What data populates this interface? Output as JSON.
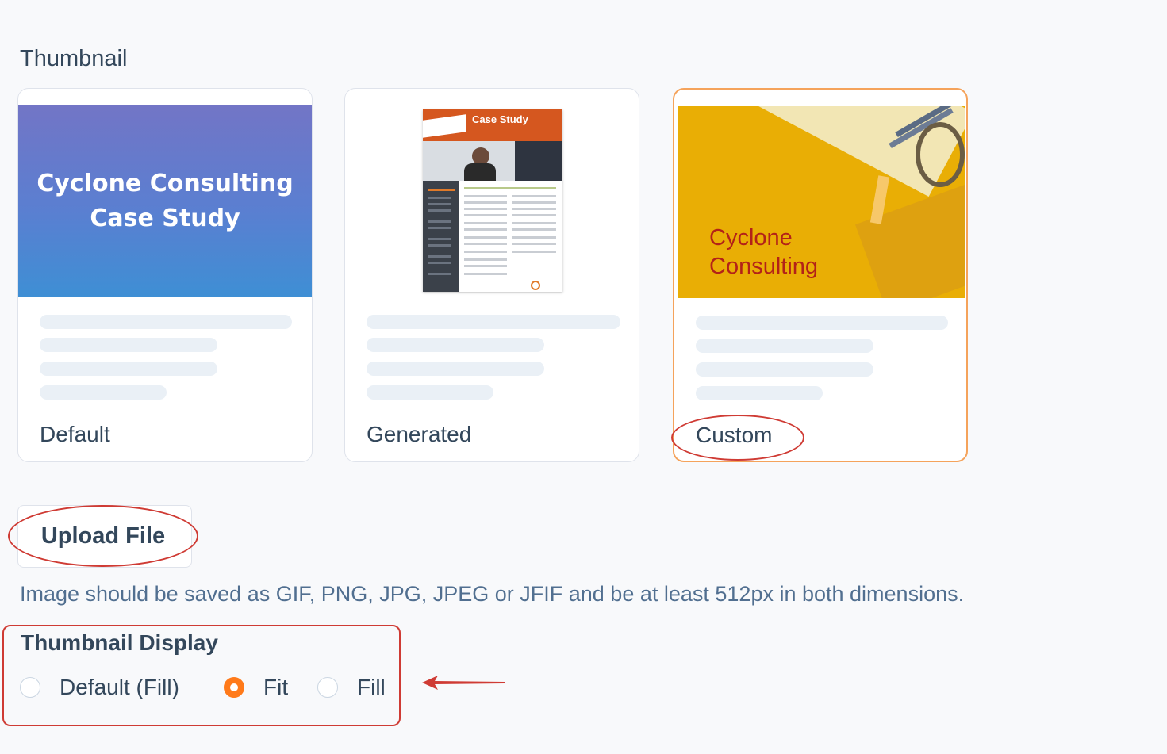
{
  "section_title": "Thumbnail",
  "cards": {
    "default": {
      "label": "Default",
      "thumb_line1": "Cyclone Consulting",
      "thumb_line2": "Case Study"
    },
    "generated": {
      "label": "Generated",
      "doc_heading": "Case Study"
    },
    "custom": {
      "label": "Custom",
      "thumb_line1": "Cyclone",
      "thumb_line2": "Consulting",
      "selected": true
    }
  },
  "upload_button": "Upload File",
  "help_text": "Image should be saved as GIF, PNG, JPG, JPEG or JFIF and be at least 512px in both dimensions.",
  "display": {
    "title": "Thumbnail Display",
    "options": [
      {
        "label": "Default (Fill)",
        "checked": false
      },
      {
        "label": "Fit",
        "checked": true
      },
      {
        "label": "Fill",
        "checked": false
      }
    ]
  },
  "colors": {
    "accent": "#ff7a1a",
    "annotation": "#cf3b34",
    "selected_border": "#f5a35b"
  }
}
